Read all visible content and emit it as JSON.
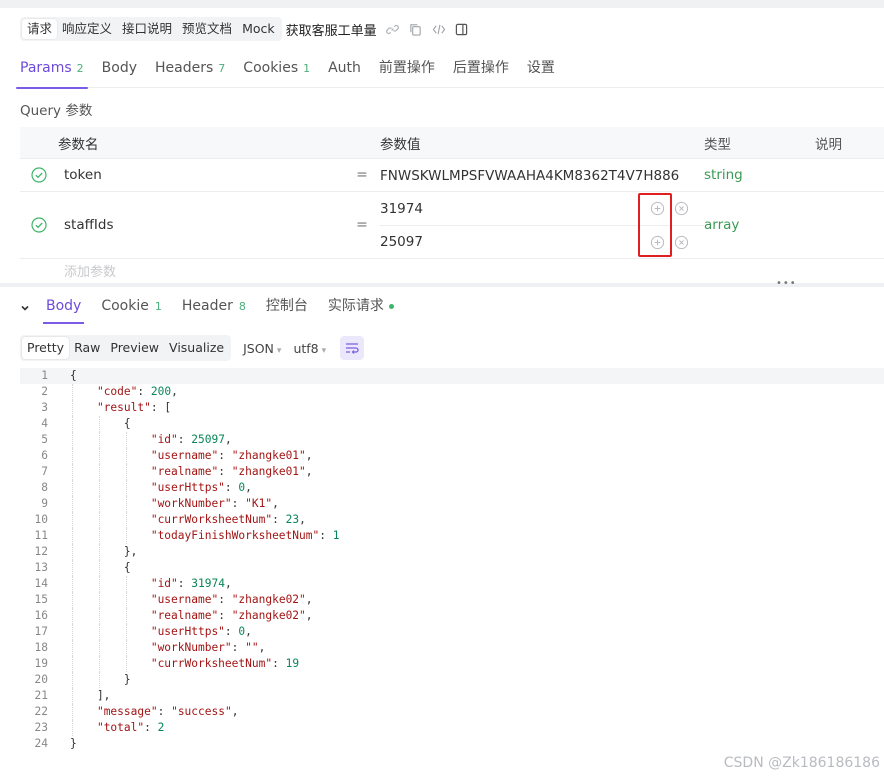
{
  "toolbar": {
    "segments": [
      "请求",
      "响应定义",
      "接口说明",
      "预览文档",
      "Mock"
    ],
    "api_name": "获取客服工单量"
  },
  "request_tabs": [
    {
      "label": "Params",
      "count": "2"
    },
    {
      "label": "Body",
      "count": ""
    },
    {
      "label": "Headers",
      "count": "7"
    },
    {
      "label": "Cookies",
      "count": "1"
    },
    {
      "label": "Auth",
      "count": ""
    },
    {
      "label": "前置操作",
      "count": ""
    },
    {
      "label": "后置操作",
      "count": ""
    },
    {
      "label": "设置",
      "count": ""
    }
  ],
  "query": {
    "title": "Query 参数",
    "headers": {
      "name": "参数名",
      "value": "参数值",
      "type": "类型",
      "desc": "说明"
    },
    "rows": [
      {
        "name": "token",
        "values": [
          "FNWSKWLMPSFVWAAHA4KM8362T4V7H886"
        ],
        "type": "string"
      },
      {
        "name": "staffIds",
        "values": [
          "31974",
          "25097"
        ],
        "type": "array"
      }
    ],
    "add_placeholder": "添加参数"
  },
  "response_tabs": [
    {
      "label": "Body",
      "count": ""
    },
    {
      "label": "Cookie",
      "count": "1"
    },
    {
      "label": "Header",
      "count": "8"
    },
    {
      "label": "控制台",
      "count": ""
    },
    {
      "label": "实际请求",
      "count": ""
    }
  ],
  "format": {
    "modes": [
      "Pretty",
      "Raw",
      "Preview",
      "Visualize"
    ],
    "language": "JSON",
    "encoding": "utf8"
  },
  "code_lines": [
    {
      "n": "1",
      "t": "{"
    },
    {
      "n": "2",
      "t": "    \"code\": 200,"
    },
    {
      "n": "3",
      "t": "    \"result\": ["
    },
    {
      "n": "4",
      "t": "        {"
    },
    {
      "n": "5",
      "t": "            \"id\": 25097,"
    },
    {
      "n": "6",
      "t": "            \"username\": \"zhangke01\","
    },
    {
      "n": "7",
      "t": "            \"realname\": \"zhangke01\","
    },
    {
      "n": "8",
      "t": "            \"userHttps\": 0,"
    },
    {
      "n": "9",
      "t": "            \"workNumber\": \"K1\","
    },
    {
      "n": "10",
      "t": "            \"currWorksheetNum\": 23,"
    },
    {
      "n": "11",
      "t": "            \"todayFinishWorksheetNum\": 1"
    },
    {
      "n": "12",
      "t": "        },"
    },
    {
      "n": "13",
      "t": "        {"
    },
    {
      "n": "14",
      "t": "            \"id\": 31974,"
    },
    {
      "n": "15",
      "t": "            \"username\": \"zhangke02\","
    },
    {
      "n": "16",
      "t": "            \"realname\": \"zhangke02\","
    },
    {
      "n": "17",
      "t": "            \"userHttps\": 0,"
    },
    {
      "n": "18",
      "t": "            \"workNumber\": \"\","
    },
    {
      "n": "19",
      "t": "            \"currWorksheetNum\": 19"
    },
    {
      "n": "20",
      "t": "        }"
    },
    {
      "n": "21",
      "t": "    ],"
    },
    {
      "n": "22",
      "t": "    \"message\": \"success\","
    },
    {
      "n": "23",
      "t": "    \"total\": 2"
    },
    {
      "n": "24",
      "t": "}"
    }
  ],
  "watermark": "CSDN @Zk186186186",
  "colors": {
    "accent": "#6c4bdc",
    "success": "#3a9a55",
    "highlight_box": "#e02020"
  }
}
